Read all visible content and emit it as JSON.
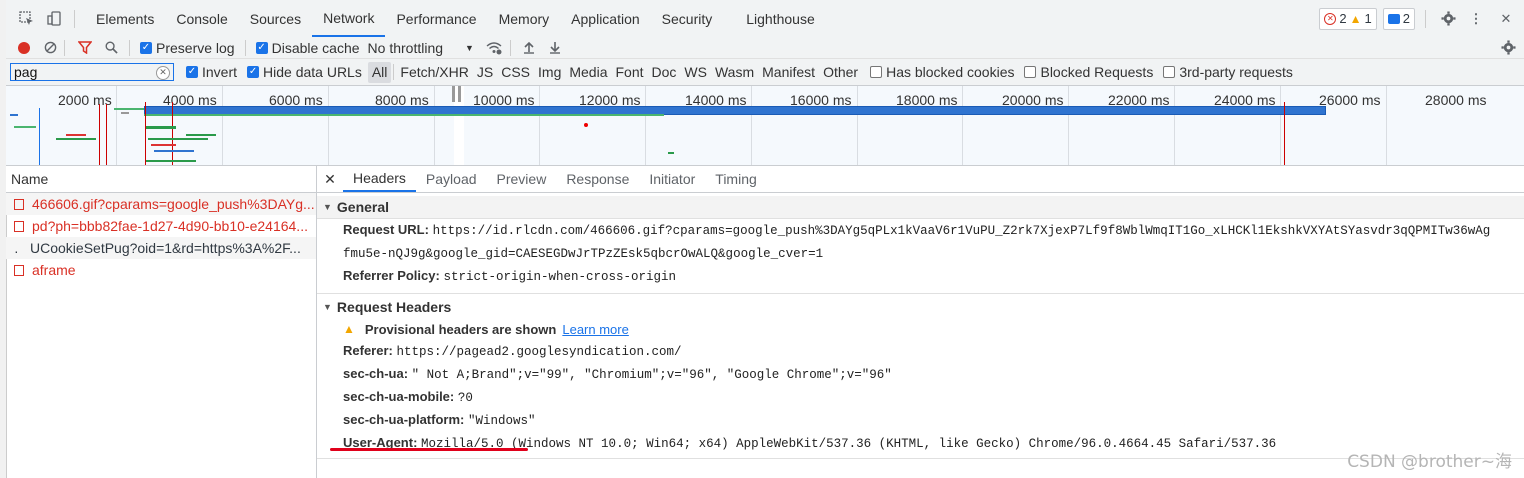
{
  "tabs": [
    "Elements",
    "Console",
    "Sources",
    "Network",
    "Performance",
    "Memory",
    "Application",
    "Security",
    "Lighthouse"
  ],
  "active_tab": "Network",
  "status": {
    "errors": "2",
    "warnings": "1",
    "messages": "2"
  },
  "toolbar": {
    "preserve_log": "Preserve log",
    "disable_cache": "Disable cache",
    "throttling": "No throttling"
  },
  "filter": {
    "value": "pag",
    "invert": "Invert",
    "hide_data_urls": "Hide data URLs",
    "types": [
      "All",
      "Fetch/XHR",
      "JS",
      "CSS",
      "Img",
      "Media",
      "Font",
      "Doc",
      "WS",
      "Wasm",
      "Manifest",
      "Other"
    ],
    "has_blocked_cookies": "Has blocked cookies",
    "blocked_requests": "Blocked Requests",
    "third_party": "3rd-party requests"
  },
  "timeline": {
    "labels": [
      "2000 ms",
      "4000 ms",
      "6000 ms",
      "8000 ms",
      "10000 ms",
      "12000 ms",
      "14000 ms",
      "16000 ms",
      "18000 ms",
      "20000 ms",
      "22000 ms",
      "24000 ms",
      "26000 ms",
      "28000 ms"
    ]
  },
  "requests": {
    "column": "Name",
    "items": [
      {
        "name": "466606.gif?cparams=google_push%3DAYg...",
        "color": "#d93025"
      },
      {
        "name": "pd?ph=bbb82fae-1d27-4d90-bb10-e24164...",
        "color": "#d93025"
      },
      {
        "name": "UCookieSetPug?oid=1&rd=https%3A%2F...",
        "color": "#303942"
      },
      {
        "name": "aframe",
        "color": "#d93025"
      }
    ]
  },
  "details": {
    "tabs": [
      "Headers",
      "Payload",
      "Preview",
      "Response",
      "Initiator",
      "Timing"
    ],
    "active": "Headers",
    "general": {
      "title": "General",
      "request_url_key": "Request URL:",
      "request_url_1": "https://id.rlcdn.com/466606.gif?cparams=google_push%3DAYg5qPLx1kVaaV6r1VuPU_Z2rk7XjexP7Lf9f8WblWmqIT1Go_xLHCKl1EkshkVXYAtSYasvdr3qQPMITw36wAg",
      "request_url_2": "fmu5e-nQJ9g&google_gid=CAESEGDwJrTPzZEsk5qbcrOwALQ&google_cver=1",
      "referrer_policy_key": "Referrer Policy:",
      "referrer_policy": "strict-origin-when-cross-origin"
    },
    "request_headers": {
      "title": "Request Headers",
      "provisional": "Provisional headers are shown",
      "learn_more": "Learn more",
      "referer_key": "Referer:",
      "referer": "https://pagead2.googlesyndication.com/",
      "sec_ch_ua_key": "sec-ch-ua:",
      "sec_ch_ua": "\" Not A;Brand\";v=\"99\", \"Chromium\";v=\"96\", \"Google Chrome\";v=\"96\"",
      "sec_ch_ua_mobile_key": "sec-ch-ua-mobile:",
      "sec_ch_ua_mobile": "?0",
      "sec_ch_ua_platform_key": "sec-ch-ua-platform:",
      "sec_ch_ua_platform": "\"Windows\"",
      "user_agent_key": "User-Agent:",
      "user_agent": "Mozilla/5.0 (Windows NT 10.0; Win64; x64) AppleWebKit/537.36 (KHTML, like Gecko) Chrome/96.0.4664.45 Safari/537.36"
    }
  },
  "watermark": "CSDN @brother~海"
}
